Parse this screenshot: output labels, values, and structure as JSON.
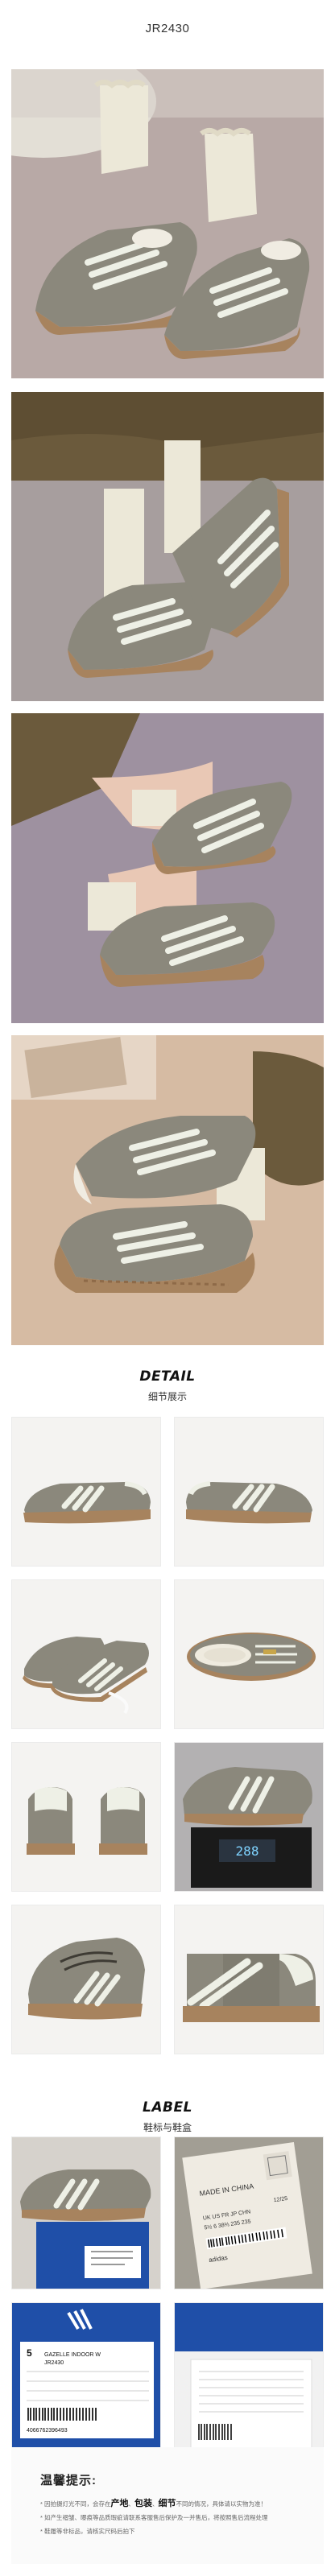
{
  "header": {
    "product_code": "JR2430"
  },
  "detail_section": {
    "title_en": "DETAIL",
    "title_cn": "细节展示"
  },
  "label_section": {
    "title_en": "LABEL",
    "title_cn": "鞋标与鞋盒"
  },
  "label_tag": {
    "made_in": "MADE IN CHINA",
    "size_header": "UK  US  FR  JP  CHN",
    "size_row": "5½  6  38⅔  235  235",
    "date": "12/25",
    "brand": "adidas"
  },
  "box_label": {
    "size_num": "5",
    "model": "GAZELLE INDOOR W",
    "code": "JR2430",
    "barcode_num": "4066762396493"
  },
  "scale_reading": "288",
  "notice": {
    "title": "温馨提示:",
    "line1_pre": "* 因拍摄灯光不同，会存在",
    "kw1": "产地",
    "sep1": "、",
    "kw2": "包装",
    "sep2": "、",
    "kw3": "细节",
    "line1_post": "不同的情况，具体请以实物为准！",
    "line2": "* 如产生褶皱、曝痕等品质瑕疵请联系客服售后保护及一并售后，将按照售后流程处理",
    "line3": "* 鞋履等非标品，请核实尺码后拍下"
  },
  "colors": {
    "suede": "#8b887c",
    "stripe": "#eef0e6",
    "gum": "#a7835e",
    "sock": "#ece8d8"
  }
}
